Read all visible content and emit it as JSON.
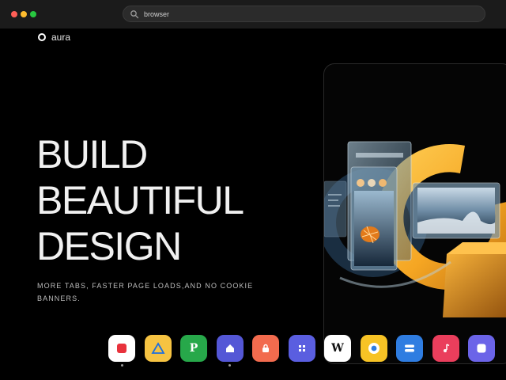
{
  "window": {
    "address": "browser"
  },
  "brand": {
    "name": "aura"
  },
  "hero": {
    "lines": [
      "BUILD",
      "BEAUTIFUL",
      "DESIGN"
    ],
    "tagline": "MORE TABS, FASTER PAGE LOADS,AND NO COOKIE BANNERS."
  },
  "colors": {
    "accent_orange": "#f5a623",
    "glass_blue": "#7fa8c4"
  },
  "dock": {
    "items": [
      {
        "icon": "red-square-app-icon",
        "letter": "",
        "bg": "#ffffff",
        "running": true
      },
      {
        "icon": "triangle-app-icon",
        "letter": "",
        "bg": "#f6c342",
        "running": false
      },
      {
        "icon": "p-app-icon",
        "letter": "P",
        "bg": "#27a84a",
        "running": false
      },
      {
        "icon": "home-app-icon",
        "letter": "",
        "bg": "#5457d6",
        "running": true
      },
      {
        "icon": "lock-app-icon",
        "letter": "",
        "bg": "#f26b4e",
        "running": false
      },
      {
        "icon": "grid-app-icon",
        "letter": "",
        "bg": "#5a5ee0",
        "running": false
      },
      {
        "icon": "w-app-icon",
        "letter": "W",
        "bg": "#ffffff",
        "running": false
      },
      {
        "icon": "chrome-app-icon",
        "letter": "",
        "bg": "#f7c325",
        "running": false
      },
      {
        "icon": "toggle-app-icon",
        "letter": "",
        "bg": "#2f7de1",
        "running": false
      },
      {
        "icon": "music-app-icon",
        "letter": "",
        "bg": "#ea3e5c",
        "running": false
      },
      {
        "icon": "square-app-icon",
        "letter": "",
        "bg": "#6b64e8",
        "running": false
      }
    ]
  }
}
